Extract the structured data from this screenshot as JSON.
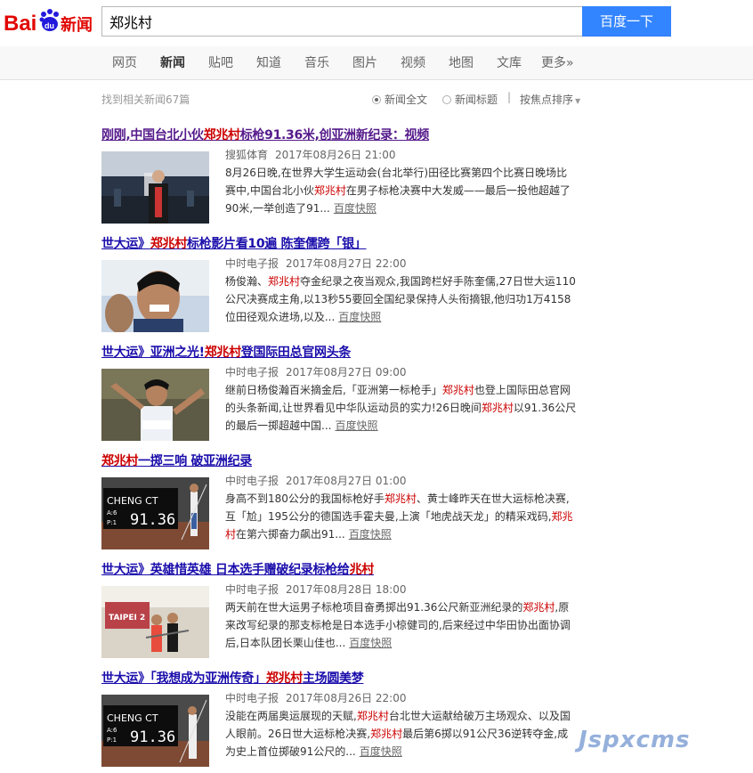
{
  "header": {
    "logo_text": "Bai",
    "logo_du": "du",
    "logo_news": "新闻",
    "search_value": "郑兆村",
    "search_button": "百度一下"
  },
  "nav": {
    "items": [
      {
        "label": "网页"
      },
      {
        "label": "新闻"
      },
      {
        "label": "贴吧"
      },
      {
        "label": "知道"
      },
      {
        "label": "音乐"
      },
      {
        "label": "图片"
      },
      {
        "label": "视频"
      },
      {
        "label": "地图"
      },
      {
        "label": "文库"
      },
      {
        "label": "更多»"
      }
    ],
    "active": "新闻"
  },
  "toolbar": {
    "count": "找到相关新闻67篇",
    "opt_full": "新闻全文",
    "opt_title": "新闻标题",
    "separator": "|",
    "sort": "按焦点排序"
  },
  "results": [
    {
      "title_parts": [
        "刚刚,中国台北小伙",
        "郑兆村",
        "标枪91.36米,创亚洲新纪录：视频"
      ],
      "source": "搜狐体育",
      "date": "2017年08月26日 21:00",
      "snippet_parts": [
        "8月26日晚,在世界大学生运动会(台北举行)田径比赛第四个比赛日晚场比赛中,中国台北小伙",
        "郑兆村",
        "在男子标枪决赛中大发威——最后一投他超越了90米,一举创造了91..."
      ],
      "cache": "百度快照"
    },
    {
      "title_parts": [
        "世大运》",
        "郑兆村",
        "标枪影片看10遍 陈奎儒跨「银」"
      ],
      "source": "中时电子报",
      "date": "2017年08月27日 22:00",
      "snippet_parts": [
        "杨俊瀚、",
        "郑兆村",
        "夺金纪录之夜当观众,我国跨栏好手陈奎儒,27日世大运110公尺决赛成主角,以13秒55要回全国纪录保持人头衔摘银,他归功1万4158位田径观众进场,以及..."
      ],
      "cache": "百度快照"
    },
    {
      "title_parts": [
        "世大运》亚洲之光!",
        "郑兆村",
        "登国际田总官网头条"
      ],
      "source": "中时电子报",
      "date": "2017年08月27日 09:00",
      "snippet_parts": [
        "继前日杨俊瀚百米摘金后,「亚洲第一标枪手」",
        "郑兆村",
        "也登上国际田总官网的头条新闻,让世界看见中华队运动员的实力!26日晚间",
        "郑兆村",
        "以91.36公尺的最后一掷超越中国..."
      ],
      "cache": "百度快照"
    },
    {
      "title_parts": [
        "郑兆村",
        "一掷三响 破亚洲纪录"
      ],
      "source": "中时电子报",
      "date": "2017年08月27日 01:00",
      "snippet_parts": [
        "身高不到180公分的我国标枪好手",
        "郑兆村",
        "、黄士峰昨天在世大运标枪决赛,互「尬」195公分的德国选手霍夫曼,上演「地虎战天龙」的精采戏码,",
        "郑兆村",
        "在第六掷奋力飙出91..."
      ],
      "cache": "百度快照"
    },
    {
      "title_parts": [
        "世大运》英雄惜英雄 日本选手赠破纪录标枪给",
        "兆村",
        ""
      ],
      "source": "中时电子报",
      "date": "2017年08月28日 18:00",
      "snippet_parts": [
        "两天前在世大运男子标枪项目奋勇掷出91.36公尺新亚洲纪录的",
        "郑兆村",
        ",原来改写纪录的那支标枪是日本选手小椋健司的,后来经过中华田协出面协调后,日本队团长栗山佳也..."
      ],
      "cache": "百度快照"
    },
    {
      "title_parts": [
        "世大运》「我想成为亚洲传奇」",
        "郑兆村",
        "主场圆美梦"
      ],
      "source": "中时电子报",
      "date": "2017年08月26日 22:00",
      "snippet_parts": [
        "没能在两届奥运展现的天赋,",
        "郑兆村",
        "台北世大运献给破万主场观众、以及国人眼前。26日世大运标枪决赛,",
        "郑兆村",
        "最后第6掷以91公尺36逆转夺金,成为史上首位掷破91公尺的..."
      ],
      "cache": "百度快照"
    }
  ],
  "thumbs": {
    "scoreboard_name": "CHENG CT",
    "scoreboard_value": "91.36",
    "scoreboard_a": "A:6",
    "scoreboard_p": "P:1",
    "banner": "TAIPEI 2"
  },
  "watermark": "Jspxcms"
}
